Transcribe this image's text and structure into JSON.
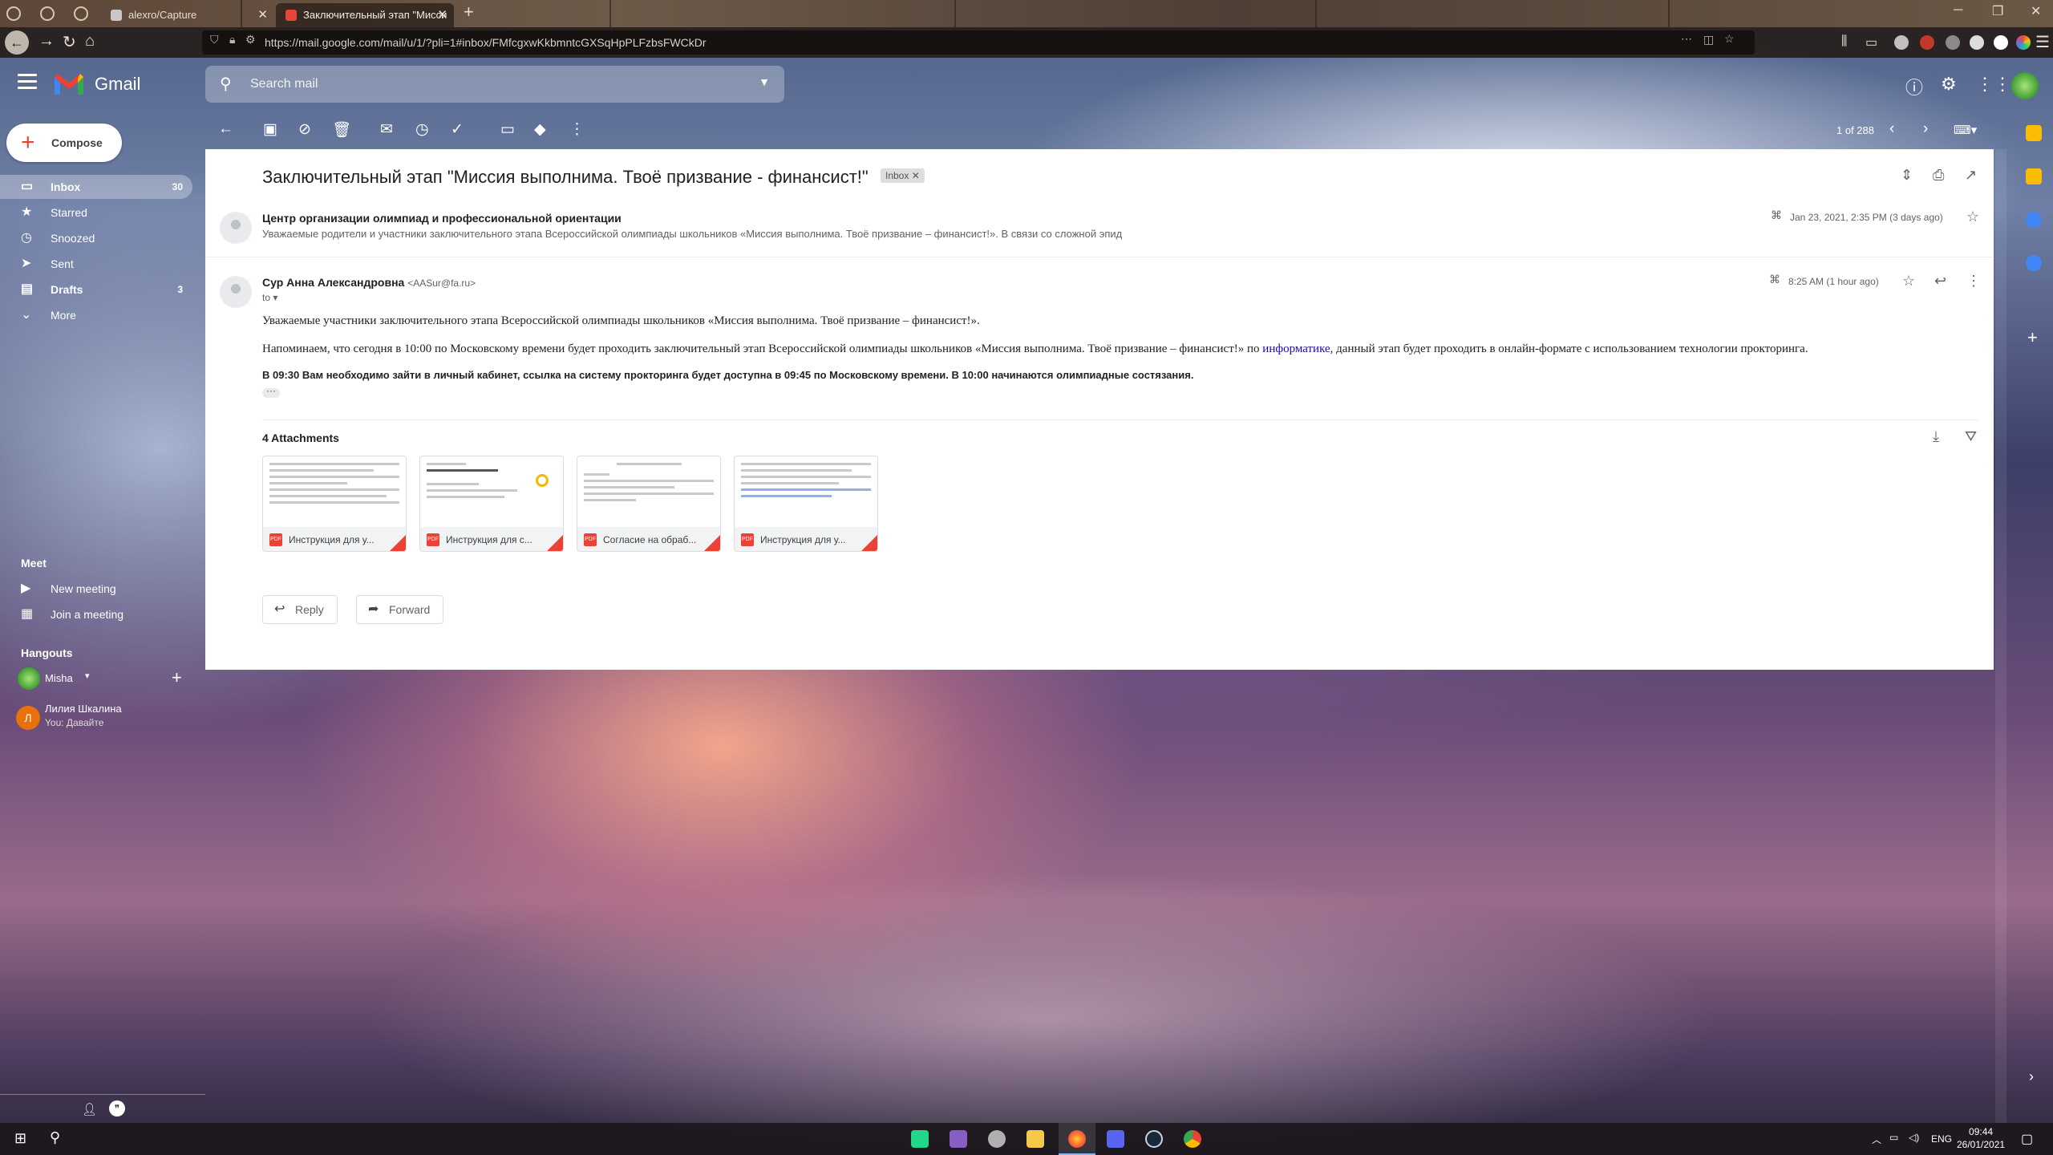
{
  "browser": {
    "tabs": [
      {
        "label": "alexro/Capture"
      },
      {
        "label": "Заключительный этап \"Мисси"
      }
    ],
    "url": "https://mail.google.com/mail/u/1/?pli=1#inbox/FMfcgxwKkbmntcGXSqHpPLFzbsFWCkDr"
  },
  "header": {
    "app_name": "Gmail",
    "search_placeholder": "Search mail"
  },
  "sidebar": {
    "compose_label": "Compose",
    "items": [
      {
        "label": "Inbox",
        "count": "30",
        "icon": "inbox-icon"
      },
      {
        "label": "Starred",
        "count": "",
        "icon": "star-icon"
      },
      {
        "label": "Snoozed",
        "count": "",
        "icon": "clock-icon"
      },
      {
        "label": "Sent",
        "count": "",
        "icon": "send-icon"
      },
      {
        "label": "Drafts",
        "count": "3",
        "icon": "draft-icon"
      },
      {
        "label": "More",
        "count": "",
        "icon": "chevron-down-icon"
      }
    ],
    "meet_title": "Meet",
    "meet_items": [
      "New meeting",
      "Join a meeting"
    ],
    "hangouts_title": "Hangouts",
    "hangouts_user": "Misha",
    "contact": {
      "initial": "Л",
      "name": "Лилия Шкалина",
      "preview": "You: Давайте"
    }
  },
  "toolbar": {
    "pager": "1 of 288"
  },
  "thread": {
    "subject": "Заключительный этап \"Миссия выполнима. Твоё призвание - финансист!\"",
    "label_chip": "Inbox",
    "message1": {
      "sender": "Центр организации олимпиад и профессиональной ориентации",
      "snippet": "Уважаемые родители и участники заключительного этапа Всероссийской олимпиады школьников «Миссия выполнима. Твоё призвание – финансист!». В связи со сложной эпид",
      "date": "Jan 23, 2021, 2:35 PM (3 days ago)"
    },
    "message2": {
      "sender": "Сур Анна Александровна",
      "email": "<AASur@fa.ru>",
      "to": "to",
      "date": "8:25 AM (1 hour ago)",
      "para1": "Уважаемые участники заключительного этапа Всероссийской олимпиады школьников «Миссия выполнима. Твоё призвание – финансист!».",
      "para2_before": "Напоминаем, что сегодня в 10:00 по Московскому времени будет проходить заключительный этап Всероссийской олимпиады школьников «Миссия выполнима. Твоё призвание – финансист!» по ",
      "para2_link": "информатике",
      "para2_after": ", данный этап будет проходить в онлайн-формате с использованием технологии прокторинга.",
      "para3": "В 09:30 Вам необходимо зайти в личный кабинет, ссылка на систему прокторинга будет доступна в 09:45 по Московскому времени. В 10:00 начинаются олимпиадные состязания."
    },
    "attachments_title": "4 Attachments",
    "attachments": [
      {
        "name": "Инструкция для у..."
      },
      {
        "name": "Инструкция для с..."
      },
      {
        "name": "Согласие на обраб..."
      },
      {
        "name": "Инструкция для у..."
      }
    ],
    "reply_label": "Reply",
    "forward_label": "Forward"
  },
  "taskbar": {
    "lang": "ENG",
    "time": "09:44",
    "date": "26/01/2021"
  }
}
